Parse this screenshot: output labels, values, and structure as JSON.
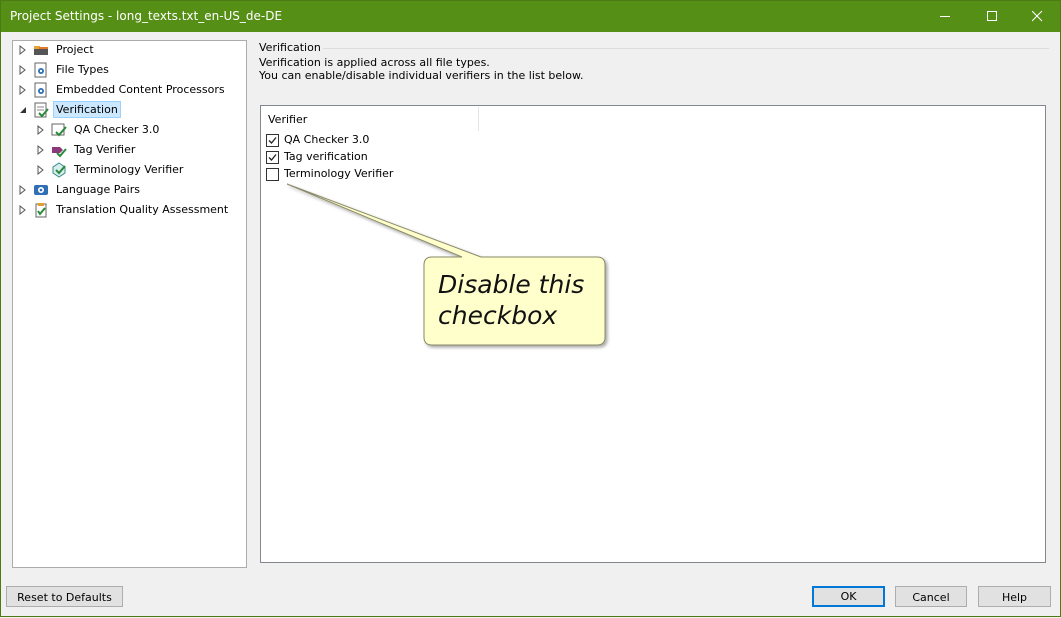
{
  "window": {
    "title": "Project Settings - long_texts.txt_en-US_de-DE",
    "controls": [
      "minimize-icon",
      "maximize-icon",
      "close-icon"
    ]
  },
  "tree": {
    "items": [
      {
        "label": "Project",
        "icon": "project-icon",
        "level": 0
      },
      {
        "label": "File Types",
        "icon": "file-types-icon",
        "level": 0
      },
      {
        "label": "Embedded Content Processors",
        "icon": "processor-icon",
        "level": 0
      },
      {
        "label": "Verification",
        "icon": "verification-icon",
        "level": 0,
        "selected": true
      },
      {
        "label": "QA Checker 3.0",
        "icon": "qa-checker-icon",
        "level": 1
      },
      {
        "label": "Tag Verifier",
        "icon": "tag-verifier-icon",
        "level": 1
      },
      {
        "label": "Terminology Verifier",
        "icon": "terminology-verifier-icon",
        "level": 1
      },
      {
        "label": "Language Pairs",
        "icon": "language-pairs-icon",
        "level": 0
      },
      {
        "label": "Translation Quality Assessment",
        "icon": "tqa-icon",
        "level": 0
      }
    ]
  },
  "verification": {
    "section_title": "Verification",
    "description_line1": "Verification is applied across all file types.",
    "description_line2": "You can enable/disable individual verifiers in the list below.",
    "column_header": "Verifier",
    "verifiers": [
      {
        "label": "QA Checker 3.0",
        "checked": true
      },
      {
        "label": "Tag verification",
        "checked": true
      },
      {
        "label": "Terminology Verifier",
        "checked": false
      }
    ]
  },
  "callout": {
    "line1": "Disable this",
    "line2": "checkbox",
    "fill_color": "#ffffcc"
  },
  "buttons": {
    "reset": "Reset to Defaults",
    "ok": "OK",
    "cancel": "Cancel",
    "help": "Help"
  },
  "colors": {
    "titlebar": "#568f16",
    "selection": "#cce8ff",
    "default_button_border": "#0078d7"
  }
}
